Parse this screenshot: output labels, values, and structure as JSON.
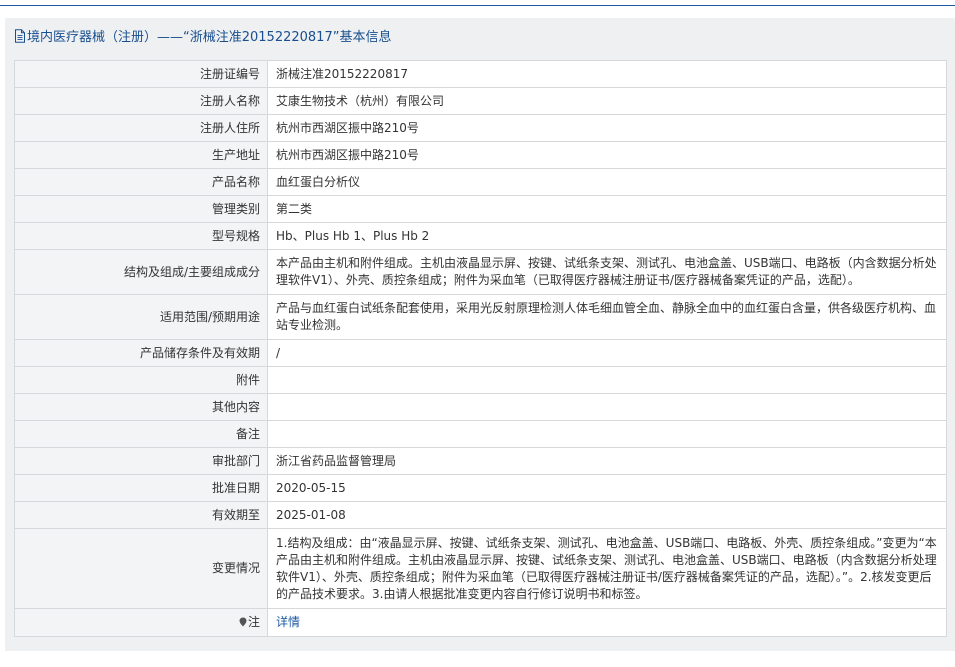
{
  "header": {
    "title": "境内医疗器械（注册）——“浙械注准20152220817”基本信息"
  },
  "rows": [
    {
      "label": "注册证编号",
      "value": "浙械注准20152220817"
    },
    {
      "label": "注册人名称",
      "value": "艾康生物技术（杭州）有限公司"
    },
    {
      "label": "注册人住所",
      "value": "杭州市西湖区振中路210号"
    },
    {
      "label": "生产地址",
      "value": "杭州市西湖区振中路210号"
    },
    {
      "label": "产品名称",
      "value": "血红蛋白分析仪"
    },
    {
      "label": "管理类别",
      "value": "第二类"
    },
    {
      "label": "型号规格",
      "value": "Hb、Plus Hb 1、Plus Hb 2"
    },
    {
      "label": "结构及组成/主要组成成分",
      "value": "本产品由主机和附件组成。主机由液晶显示屏、按键、试纸条支架、测试孔、电池盒盖、USB端口、电路板（内含数据分析处理软件V1）、外壳、质控条组成；附件为采血笔（已取得医疗器械注册证书/医疗器械备案凭证的产品，选配）。"
    },
    {
      "label": "适用范围/预期用途",
      "value": "产品与血红蛋白试纸条配套使用，采用光反射原理检测人体毛细血管全血、静脉全血中的血红蛋白含量，供各级医疗机构、血站专业检测。"
    },
    {
      "label": "产品储存条件及有效期",
      "value": "/"
    },
    {
      "label": "附件",
      "value": ""
    },
    {
      "label": "其他内容",
      "value": ""
    },
    {
      "label": "备注",
      "value": ""
    },
    {
      "label": "审批部门",
      "value": "浙江省药品监督管理局"
    },
    {
      "label": "批准日期",
      "value": "2020-05-15"
    },
    {
      "label": "有效期至",
      "value": "2025-01-08"
    },
    {
      "label": "变更情况",
      "value": "1.结构及组成：由“液晶显示屏、按键、试纸条支架、测试孔、电池盒盖、USB端口、电路板、外壳、质控条组成。”变更为“本产品由主机和附件组成。主机由液晶显示屏、按键、试纸条支架、测试孔、电池盒盖、USB端口、电路板（内含数据分析处理软件V1）、外壳、质控条组成；附件为采血笔（已取得医疗器械注册证书/医疗器械备案凭证的产品，选配）。”。2.核发变更后的产品技术要求。3.由请人根据批准变更内容自行修订说明书和标签。"
    }
  ],
  "note": {
    "label": "注",
    "icon": "pin-icon",
    "link_text": "详情"
  },
  "colors": {
    "header_text": "#1a4f8f",
    "link": "#1e5aa0",
    "label_bg": "#f3f4f6",
    "panel_bg": "#eef0f2",
    "border": "#d6d8db"
  }
}
